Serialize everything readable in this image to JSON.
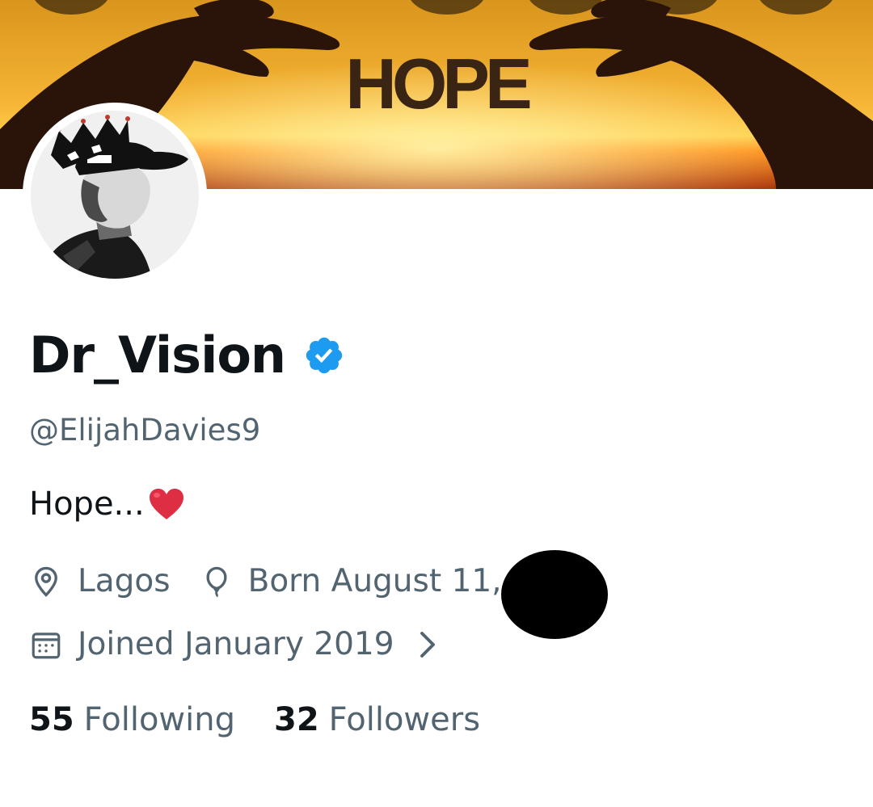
{
  "banner": {
    "text": "HOPE",
    "colors": {
      "sky_top": "#e8a11e",
      "sky_mid": "#f7b733",
      "horizon": "#ff7a00",
      "sea": "#b5360b",
      "hands": "#2a140a"
    }
  },
  "profile": {
    "display_name": "Dr_Vision",
    "handle": "@ElijahDavies9",
    "bio": "Hope...",
    "bio_emoji": "red-heart",
    "verified": true,
    "verified_color": "#1d9bf0"
  },
  "meta": {
    "location": "Lagos",
    "birthday": "Born August 11,",
    "joined": "Joined January 2019",
    "icons": [
      "location-pin-icon",
      "balloon-icon",
      "calendar-icon",
      "chevron-right-icon"
    ]
  },
  "stats": {
    "following_count": "55",
    "following_label": "Following",
    "followers_count": "32",
    "followers_label": "Followers"
  },
  "colors": {
    "primary_text": "#0f1419",
    "secondary_text": "#536471",
    "background": "#ffffff"
  }
}
